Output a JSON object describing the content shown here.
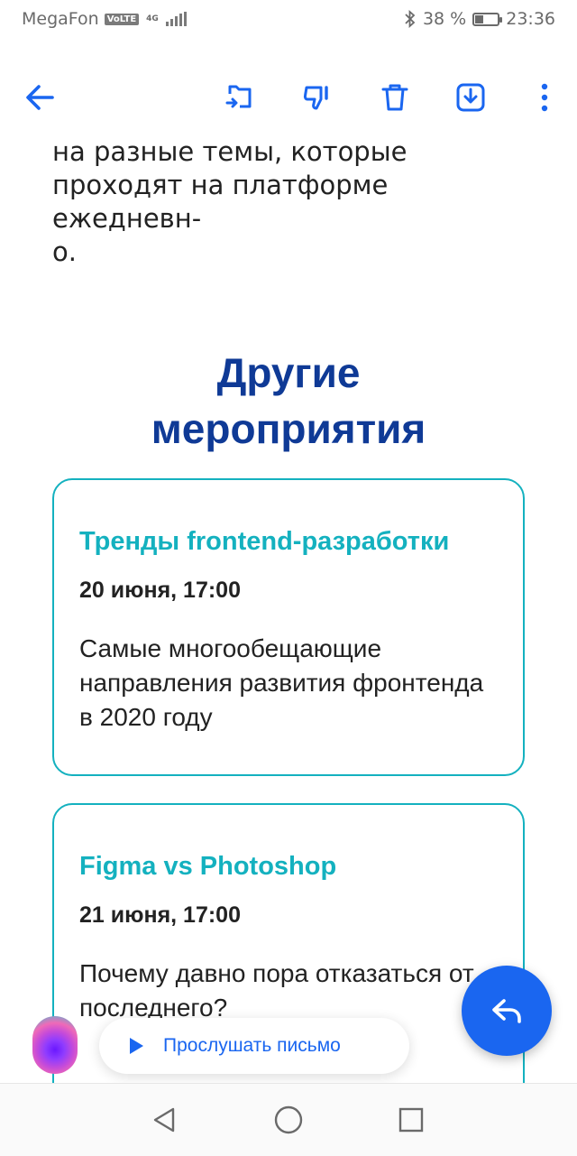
{
  "status_bar": {
    "carrier": "MegaFon",
    "volte": "VoLTE",
    "network": "4G",
    "battery": "38 %",
    "battery_level": 0.38,
    "time": "23:36"
  },
  "toolbar": {
    "back_icon": "arrow-left-icon",
    "actions": [
      "move-to-folder-icon",
      "dislike-icon",
      "delete-icon",
      "download-icon",
      "more-vertical-icon"
    ],
    "accent_color": "#1a66f0"
  },
  "email": {
    "paragraph_lines": [
      "на разные темы, которые",
      "проходят на платформе ежедневн-",
      "о."
    ],
    "section_title_lines": [
      "Другие",
      "мероприятия"
    ],
    "events": [
      {
        "title": "Тренды frontend-разработки",
        "date": "20 июня, 17:00",
        "description": "Самые многообещающие направления развития фронтенда в 2020 году"
      },
      {
        "title": "Figma vs Photoshop",
        "date": "21 июня, 17:00",
        "description": "Почему давно пора отказаться от последнего?"
      }
    ],
    "title_color": "#0f3a96",
    "card_accent_color": "#14b1bf"
  },
  "listen_button": {
    "label": "Прослушать письмо"
  },
  "fab": {
    "icon": "reply-icon"
  },
  "nav_bar": {
    "buttons": [
      "back-triangle-icon",
      "home-circle-icon",
      "recents-square-icon"
    ]
  }
}
